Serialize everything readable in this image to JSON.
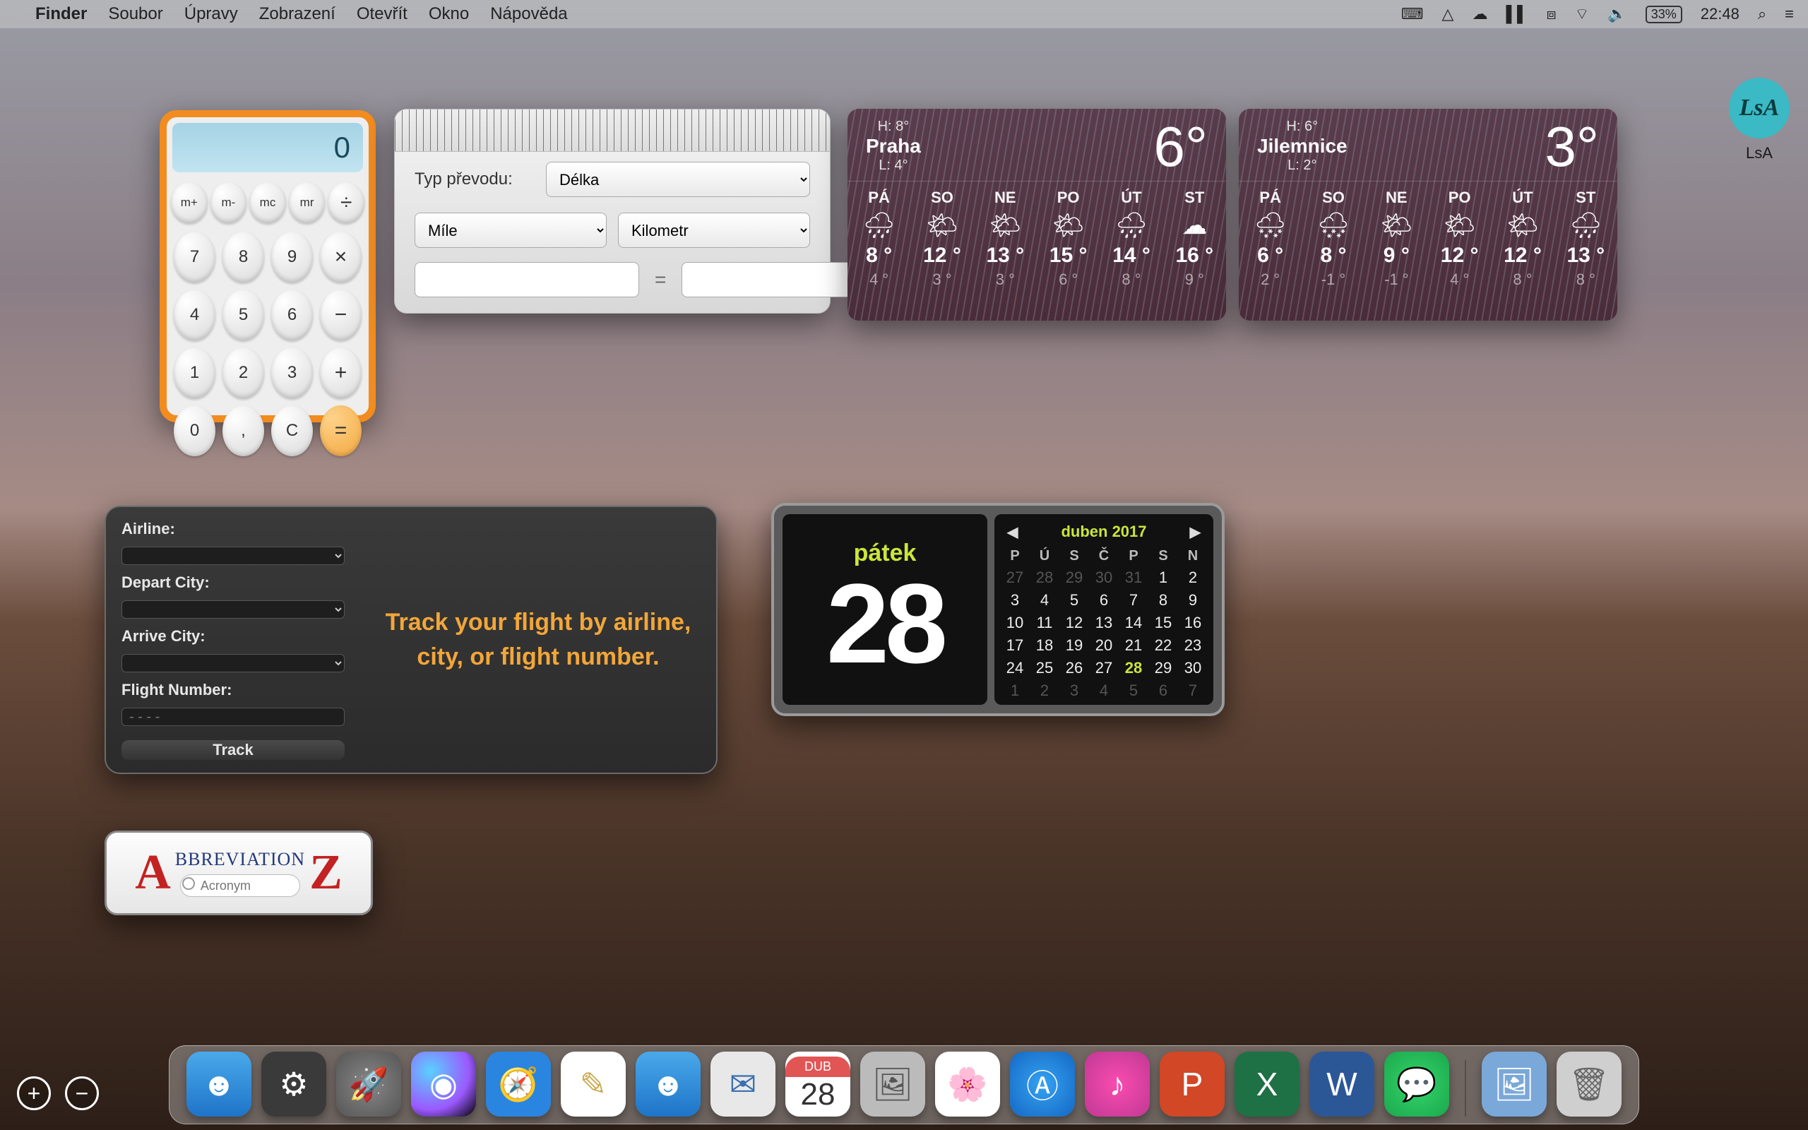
{
  "menubar": {
    "app": "Finder",
    "items": [
      "Soubor",
      "Úpravy",
      "Zobrazení",
      "Otevřít",
      "Okno",
      "Nápověda"
    ],
    "battery": "33%",
    "time": "22:48"
  },
  "lsa": {
    "badge": "LsA",
    "label": "LsA"
  },
  "calculator": {
    "display": "0",
    "mem": [
      "m+",
      "m-",
      "mc",
      "mr",
      "÷"
    ],
    "rows": [
      [
        "7",
        "8",
        "9",
        "×"
      ],
      [
        "4",
        "5",
        "6",
        "−"
      ],
      [
        "1",
        "2",
        "3",
        "+"
      ],
      [
        "0",
        ",",
        "C",
        "="
      ]
    ]
  },
  "converter": {
    "title": "Typ převodu:",
    "type": "Délka",
    "unit_from": "Míle",
    "unit_to": "Kilometr",
    "value_from": "",
    "value_to": "",
    "equals": "="
  },
  "weather": [
    {
      "city": "Praha",
      "hi": "H: 8°",
      "lo": "L: 4°",
      "temp": "6°",
      "days": [
        {
          "d": "PÁ",
          "icon": "rain",
          "hi": "8 °",
          "lo": "4 °"
        },
        {
          "d": "SO",
          "icon": "sun",
          "hi": "12 °",
          "lo": "3 °"
        },
        {
          "d": "NE",
          "icon": "sun",
          "hi": "13 °",
          "lo": "3 °"
        },
        {
          "d": "PO",
          "icon": "sun",
          "hi": "15 °",
          "lo": "6 °"
        },
        {
          "d": "ÚT",
          "icon": "rain",
          "hi": "14 °",
          "lo": "8 °"
        },
        {
          "d": "ST",
          "icon": "cloud",
          "hi": "16 °",
          "lo": "9 °"
        }
      ]
    },
    {
      "city": "Jilemnice",
      "hi": "H: 6°",
      "lo": "L: 2°",
      "temp": "3°",
      "days": [
        {
          "d": "PÁ",
          "icon": "snow",
          "hi": "6 °",
          "lo": "2 °"
        },
        {
          "d": "SO",
          "icon": "snow",
          "hi": "8 °",
          "lo": "-1 °"
        },
        {
          "d": "NE",
          "icon": "sun",
          "hi": "9 °",
          "lo": "-1 °"
        },
        {
          "d": "PO",
          "icon": "sun",
          "hi": "12 °",
          "lo": "4 °"
        },
        {
          "d": "ÚT",
          "icon": "sun",
          "hi": "12 °",
          "lo": "8 °"
        },
        {
          "d": "ST",
          "icon": "rain",
          "hi": "13 °",
          "lo": "8 °"
        }
      ]
    }
  ],
  "flight": {
    "labels": {
      "airline": "Airline:",
      "depart": "Depart City:",
      "arrive": "Arrive City:",
      "number": "Flight Number:"
    },
    "number_placeholder": "- - - -",
    "track": "Track",
    "message": "Track your flight by airline, city, or flight number."
  },
  "calendar": {
    "dow": "pátek",
    "day": "28",
    "month_label": "duben 2017",
    "headers": [
      "P",
      "Ú",
      "S",
      "Č",
      "P",
      "S",
      "N"
    ],
    "cells": [
      {
        "n": "27",
        "dim": true
      },
      {
        "n": "28",
        "dim": true
      },
      {
        "n": "29",
        "dim": true
      },
      {
        "n": "30",
        "dim": true
      },
      {
        "n": "31",
        "dim": true
      },
      {
        "n": "1"
      },
      {
        "n": "2"
      },
      {
        "n": "3"
      },
      {
        "n": "4"
      },
      {
        "n": "5"
      },
      {
        "n": "6"
      },
      {
        "n": "7"
      },
      {
        "n": "8"
      },
      {
        "n": "9"
      },
      {
        "n": "10"
      },
      {
        "n": "11"
      },
      {
        "n": "12"
      },
      {
        "n": "13"
      },
      {
        "n": "14"
      },
      {
        "n": "15"
      },
      {
        "n": "16"
      },
      {
        "n": "17"
      },
      {
        "n": "18"
      },
      {
        "n": "19"
      },
      {
        "n": "20"
      },
      {
        "n": "21"
      },
      {
        "n": "22"
      },
      {
        "n": "23"
      },
      {
        "n": "24"
      },
      {
        "n": "25"
      },
      {
        "n": "26"
      },
      {
        "n": "27"
      },
      {
        "n": "28",
        "today": true
      },
      {
        "n": "29"
      },
      {
        "n": "30"
      },
      {
        "n": "1",
        "dim": true
      },
      {
        "n": "2",
        "dim": true
      },
      {
        "n": "3",
        "dim": true
      },
      {
        "n": "4",
        "dim": true
      },
      {
        "n": "5",
        "dim": true
      },
      {
        "n": "6",
        "dim": true
      },
      {
        "n": "7",
        "dim": true
      }
    ]
  },
  "abbr": {
    "title": "BBREVIATION",
    "placeholder": "Acronym",
    "A": "A",
    "Z": "Z"
  },
  "dock": {
    "cal_top": "DUB",
    "cal_day": "28",
    "icons": [
      "finder",
      "settings",
      "launchpad",
      "siri",
      "safari",
      "notes",
      "finder2",
      "mail",
      "cal",
      "printer",
      "photos",
      "appstore",
      "music",
      "ppt",
      "excel",
      "word",
      "messages",
      "images",
      "trash"
    ]
  },
  "icon_glyphs": {
    "rain": "🌧",
    "sun": "🌤",
    "cloud": "☁",
    "snow": "🌨"
  }
}
